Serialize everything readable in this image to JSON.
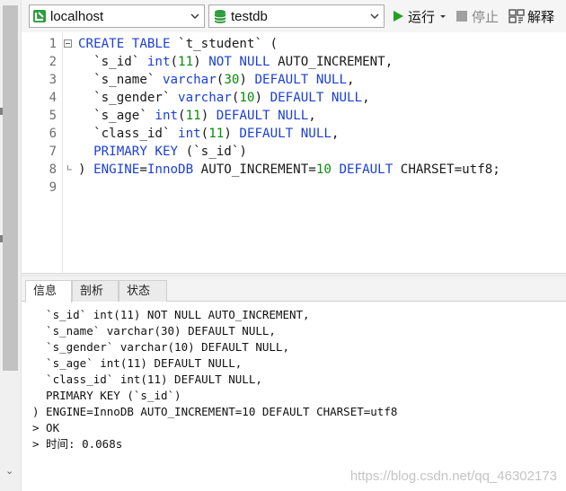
{
  "toolbar": {
    "connection": "localhost",
    "database": "testdb",
    "run_label": "运行",
    "stop_label": "停止",
    "explain_label": "解释",
    "colors": {
      "run_green": "#1fa21f",
      "db_green": "#2e9b3c"
    }
  },
  "editor": {
    "line_numbers": [
      "1",
      "2",
      "3",
      "4",
      "5",
      "6",
      "7",
      "8",
      "9"
    ],
    "lines": [
      [
        {
          "t": "CREATE TABLE",
          "c": "kw"
        },
        {
          "t": " `t_student` (",
          "c": ""
        }
      ],
      [
        {
          "t": "  `s_id` ",
          "c": ""
        },
        {
          "t": "int",
          "c": "kw"
        },
        {
          "t": "(",
          "c": ""
        },
        {
          "t": "11",
          "c": "num"
        },
        {
          "t": ") ",
          "c": ""
        },
        {
          "t": "NOT NULL",
          "c": "kw"
        },
        {
          "t": " AUTO_INCREMENT,",
          "c": ""
        }
      ],
      [
        {
          "t": "  `s_name` ",
          "c": ""
        },
        {
          "t": "varchar",
          "c": "kw"
        },
        {
          "t": "(",
          "c": ""
        },
        {
          "t": "30",
          "c": "num"
        },
        {
          "t": ") ",
          "c": ""
        },
        {
          "t": "DEFAULT NULL",
          "c": "kw"
        },
        {
          "t": ",",
          "c": ""
        }
      ],
      [
        {
          "t": "  `s_gender` ",
          "c": ""
        },
        {
          "t": "varchar",
          "c": "kw"
        },
        {
          "t": "(",
          "c": ""
        },
        {
          "t": "10",
          "c": "num"
        },
        {
          "t": ") ",
          "c": ""
        },
        {
          "t": "DEFAULT NULL",
          "c": "kw"
        },
        {
          "t": ",",
          "c": ""
        }
      ],
      [
        {
          "t": "  `s_age` ",
          "c": ""
        },
        {
          "t": "int",
          "c": "kw"
        },
        {
          "t": "(",
          "c": ""
        },
        {
          "t": "11",
          "c": "num"
        },
        {
          "t": ") ",
          "c": ""
        },
        {
          "t": "DEFAULT NULL",
          "c": "kw"
        },
        {
          "t": ",",
          "c": ""
        }
      ],
      [
        {
          "t": "  `class_id` ",
          "c": ""
        },
        {
          "t": "int",
          "c": "kw"
        },
        {
          "t": "(",
          "c": ""
        },
        {
          "t": "11",
          "c": "num"
        },
        {
          "t": ") ",
          "c": ""
        },
        {
          "t": "DEFAULT NULL",
          "c": "kw"
        },
        {
          "t": ",",
          "c": ""
        }
      ],
      [
        {
          "t": "  PRIMARY KEY",
          "c": "kw"
        },
        {
          "t": " (`s_id`)",
          "c": ""
        }
      ],
      [
        {
          "t": ") ",
          "c": ""
        },
        {
          "t": "ENGINE",
          "c": "kw"
        },
        {
          "t": "=",
          "c": ""
        },
        {
          "t": "InnoDB",
          "c": "kw"
        },
        {
          "t": " AUTO_INCREMENT=",
          "c": ""
        },
        {
          "t": "10",
          "c": "num"
        },
        {
          "t": " ",
          "c": ""
        },
        {
          "t": "DEFAULT",
          "c": "kw"
        },
        {
          "t": " CHARSET=utf8;",
          "c": ""
        }
      ],
      []
    ]
  },
  "tabs": [
    {
      "label": "信息",
      "active": true
    },
    {
      "label": "剖析",
      "active": false
    },
    {
      "label": "状态",
      "active": false
    }
  ],
  "result_log": [
    "  `s_id` int(11) NOT NULL AUTO_INCREMENT,",
    "  `s_name` varchar(30) DEFAULT NULL,",
    "  `s_gender` varchar(10) DEFAULT NULL,",
    "  `s_age` int(11) DEFAULT NULL,",
    "  `class_id` int(11) DEFAULT NULL,",
    "  PRIMARY KEY (`s_id`)",
    ") ENGINE=InnoDB AUTO_INCREMENT=10 DEFAULT CHARSET=utf8",
    "> OK",
    "> 时间: 0.068s"
  ],
  "watermark": "https://blog.csdn.net/qq_46302173"
}
